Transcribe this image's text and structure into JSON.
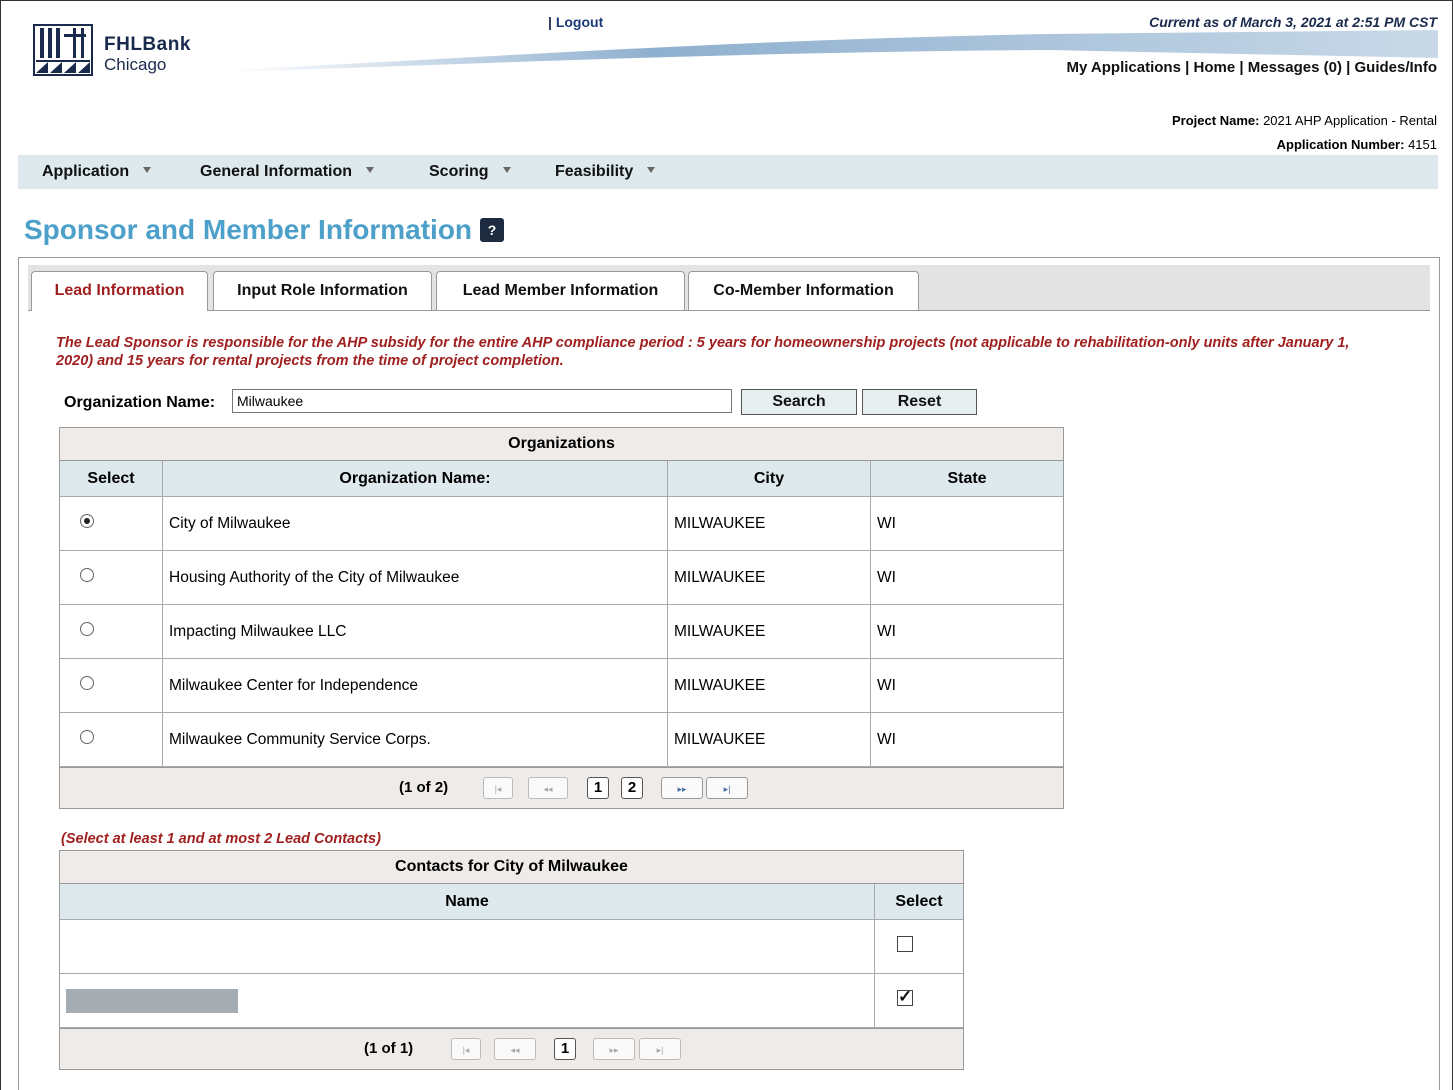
{
  "brand": {
    "line1": "FHLBank",
    "line2": "Chicago"
  },
  "header": {
    "logout_prefix": "| ",
    "logout_label": "Logout",
    "current_as_of": "Current as of March 3, 2021 at 2:51 PM CST",
    "nav": [
      "My Applications",
      "Home",
      "Messages (0)",
      "Guides/Info"
    ],
    "nav_sep": " | "
  },
  "project": {
    "name_label": "Project Name:",
    "name_value": "2021 AHP Application - Rental",
    "number_label": "Application Number:",
    "number_value": "4151"
  },
  "menu": {
    "items": [
      {
        "label": "Application"
      },
      {
        "label": "General Information"
      },
      {
        "label": "Scoring"
      },
      {
        "label": "Feasibility"
      }
    ]
  },
  "page": {
    "title": "Sponsor and Member Information",
    "help": "?"
  },
  "tabs": [
    {
      "label": "Lead Information",
      "active": true
    },
    {
      "label": "Input Role Information",
      "active": false
    },
    {
      "label": "Lead Member Information",
      "active": false
    },
    {
      "label": "Co-Member Information",
      "active": false
    }
  ],
  "notice": "The Lead Sponsor is responsible for the AHP subsidy for the entire AHP compliance period : 5 years for homeownership projects (not applicable to rehabilitation-only units after January 1, 2020) and 15 years for rental projects from the time of project completion.",
  "search": {
    "label": "Organization Name:",
    "value": "Milwaukee",
    "search_button": "Search",
    "reset_button": "Reset"
  },
  "organizations": {
    "caption": "Organizations",
    "columns": [
      "Select",
      "Organization Name:",
      "City",
      "State"
    ],
    "rows": [
      {
        "selected": true,
        "name": "City of Milwaukee",
        "city": "MILWAUKEE",
        "state": "WI"
      },
      {
        "selected": false,
        "name": "Housing Authority of the City of Milwaukee",
        "city": "MILWAUKEE",
        "state": "WI"
      },
      {
        "selected": false,
        "name": "Impacting Milwaukee LLC",
        "city": "MILWAUKEE",
        "state": "WI"
      },
      {
        "selected": false,
        "name": "Milwaukee Center for Independence",
        "city": "MILWAUKEE",
        "state": "WI"
      },
      {
        "selected": false,
        "name": "Milwaukee Community Service Corps.",
        "city": "MILWAUKEE",
        "state": "WI"
      }
    ],
    "pager": {
      "text": "(1 of 2)",
      "pages": [
        "1",
        "2"
      ]
    }
  },
  "contacts": {
    "note": "(Select at least 1 and at most 2 Lead Contacts)",
    "caption": "Contacts for City of Milwaukee",
    "columns": [
      "Name",
      "Select"
    ],
    "rows": [
      {
        "name": "",
        "checked": false,
        "redacted": false
      },
      {
        "name": "",
        "checked": true,
        "redacted": true
      }
    ],
    "pager": {
      "text": "(1 of 1)",
      "pages": [
        "1"
      ]
    }
  },
  "pager_icons": {
    "first": "|◂",
    "prev": "◂◂",
    "next": "▸▸",
    "last": "▸|"
  }
}
